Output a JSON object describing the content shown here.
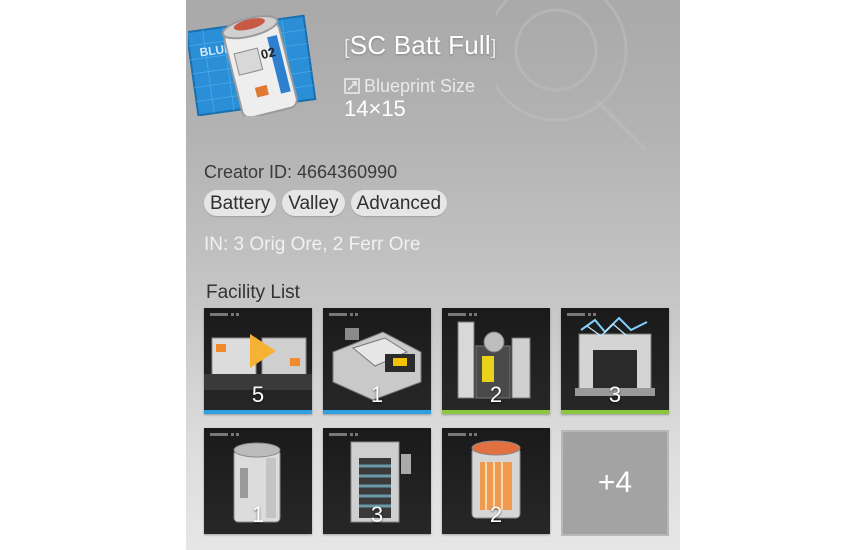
{
  "blueprint": {
    "name": "SC Batt Full",
    "bracket_open": "[",
    "bracket_close": "]",
    "size_label": "Blueprint Size",
    "size_value": "14×15",
    "thumb_text": "BLUEPRINT",
    "thumb_code": "02"
  },
  "creator": {
    "text": "Creator ID: 4664360990"
  },
  "tags": [
    "Battery",
    "Valley",
    "Advanced"
  ],
  "inputs": {
    "text": "IN: 3 Orig Ore, 2 Ferr Ore"
  },
  "facility_list": {
    "label": "Facility List",
    "items": [
      {
        "icon": "conveyor-splitter-icon",
        "count": "5",
        "accent": "#2f9fe0"
      },
      {
        "icon": "crusher-machine-icon",
        "count": "1",
        "accent": "#2f9fe0"
      },
      {
        "icon": "refinery-tower-icon",
        "count": "2",
        "accent": "#8cc63f"
      },
      {
        "icon": "power-relay-icon",
        "count": "3",
        "accent": "#8cc63f"
      },
      {
        "icon": "storage-cell-icon",
        "count": "1",
        "accent": ""
      },
      {
        "icon": "coil-canister-icon",
        "count": "3",
        "accent": ""
      },
      {
        "icon": "battery-cell-icon",
        "count": "2",
        "accent": ""
      }
    ],
    "more_label": "+4"
  },
  "colors": {
    "blue_accent": "#2f9fe0",
    "green_accent": "#8cc63f",
    "blueprint_bg": "#2a8fd6"
  }
}
